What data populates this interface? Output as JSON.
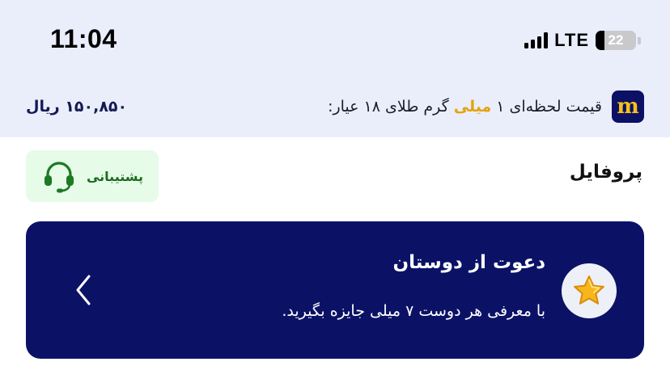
{
  "status_bar": {
    "time": "11:04",
    "network": "LTE",
    "battery_level": "22",
    "battery_fraction": 0.22,
    "signal_bars": 4
  },
  "gold_price": {
    "logo_letter": "m",
    "title_before": "قیمت لحظه‌ای ۱",
    "title_highlight": "میلی",
    "title_after": "گرم طلای ۱۸ عیار:",
    "value": "۱۵۰,۸۵۰ ریال",
    "highlight_color": "#e3a40e"
  },
  "profile": {
    "title": "پروفایل",
    "support_label": "پشتیبانی"
  },
  "invite_card": {
    "title": "دعوت از دوستان",
    "subtitle": "با معرفی هر دوست ۷ میلی جایزه بگیرید.",
    "background_color": "#0b1266"
  },
  "icons": {
    "headset": "headset-icon",
    "star": "star-icon",
    "chevron": "chevron-left-icon",
    "logo": "app-logo"
  }
}
